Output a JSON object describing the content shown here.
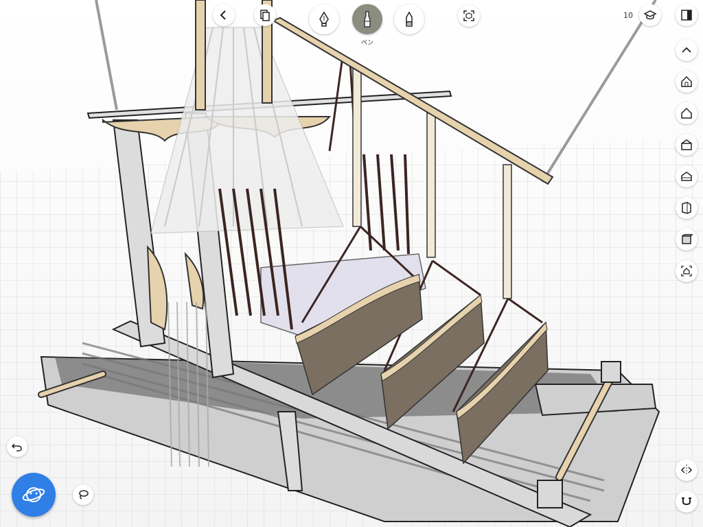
{
  "toolbar": {
    "active_tool_label": "ペン",
    "tools": [
      {
        "icon": "fountain-pen-icon"
      },
      {
        "icon": "brush-pen-icon"
      },
      {
        "icon": "marker-pen-icon"
      }
    ]
  },
  "header": {
    "count": "10"
  },
  "right_rail": [
    {
      "icon": "chevron-up-icon"
    },
    {
      "icon": "home-outline-icon"
    },
    {
      "icon": "house-icon"
    },
    {
      "icon": "house-front-icon"
    },
    {
      "icon": "house-iso-icon"
    },
    {
      "icon": "box-side-icon"
    },
    {
      "icon": "box-iso-icon"
    },
    {
      "icon": "home-frame-icon"
    }
  ],
  "colors": {
    "accent": "#2f7fe6",
    "active_tool": "#8a8d80",
    "wood": "#e6d2ad",
    "dark_wood": "#3b2522",
    "grid": "#d8d8d8"
  }
}
